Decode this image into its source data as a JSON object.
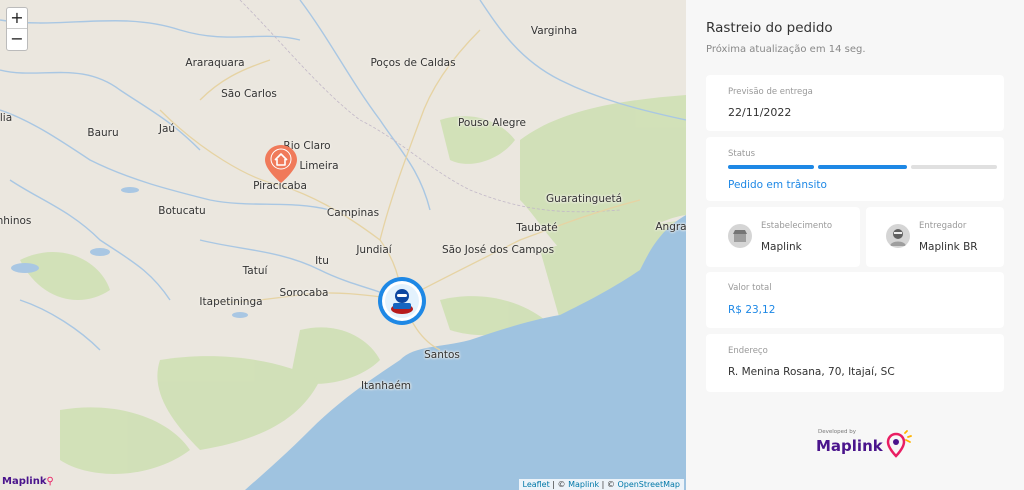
{
  "map": {
    "zoom_in_label": "+",
    "zoom_out_label": "−",
    "cities": [
      {
        "name": "Varginha"
      },
      {
        "name": "Araraquara"
      },
      {
        "name": "Poços de Caldas"
      },
      {
        "name": "São Carlos"
      },
      {
        "name": "Bauru"
      },
      {
        "name": "Jaú"
      },
      {
        "name": "Rio Claro"
      },
      {
        "name": "Pouso Alegre"
      },
      {
        "name": "Limeira"
      },
      {
        "name": "Piracicaba"
      },
      {
        "name": "Guaratinguetá"
      },
      {
        "name": "Botucatu"
      },
      {
        "name": "Campinas"
      },
      {
        "name": "Taubaté"
      },
      {
        "name": "Jundiaí"
      },
      {
        "name": "São José dos Campos"
      },
      {
        "name": "Itu"
      },
      {
        "name": "Tatuí"
      },
      {
        "name": "Sorocaba"
      },
      {
        "name": "Itapetininga"
      },
      {
        "name": "Santos"
      },
      {
        "name": "Itanhaém"
      },
      {
        "name": "Angra"
      },
      {
        "name": "nhinos"
      },
      {
        "name": "lia"
      }
    ],
    "logo_text": "Maplink",
    "attribution": {
      "leaflet": "Leaflet",
      "sep1": " | © ",
      "maplink": "Maplink",
      "sep2": " | © ",
      "osm": "OpenStreetMap"
    },
    "colors": {
      "land": "#ebe7df",
      "water": "#9fc3e0",
      "park": "#cfe0b4",
      "home_pin": "#f07a5a",
      "driver_ring": "#1e88e5"
    }
  },
  "panel": {
    "title": "Rastreio do pedido",
    "subtitle": "Próxima atualização em 14 seg.",
    "delivery_forecast": {
      "label": "Previsão de entrega",
      "value": "22/11/2022"
    },
    "status": {
      "label": "Status",
      "value": "Pedido em trânsito",
      "progress_steps_done": 2,
      "progress_steps_total": 3
    },
    "establishment": {
      "label": "Estabelecimento",
      "value": "Maplink"
    },
    "courier": {
      "label": "Entregador",
      "value": "Maplink BR"
    },
    "total": {
      "label": "Valor total",
      "value": "R$ 23,12"
    },
    "address": {
      "label": "Endereço",
      "value": "R. Menina Rosana, 70, Itajaí, SC"
    },
    "developed_by": {
      "small": "Developed by",
      "brand": "Maplink"
    },
    "colors": {
      "accent": "#1e88e5",
      "bar_empty": "#e0e0e0",
      "brand": "#4a148c",
      "brand_pin": "#e91e63"
    }
  }
}
